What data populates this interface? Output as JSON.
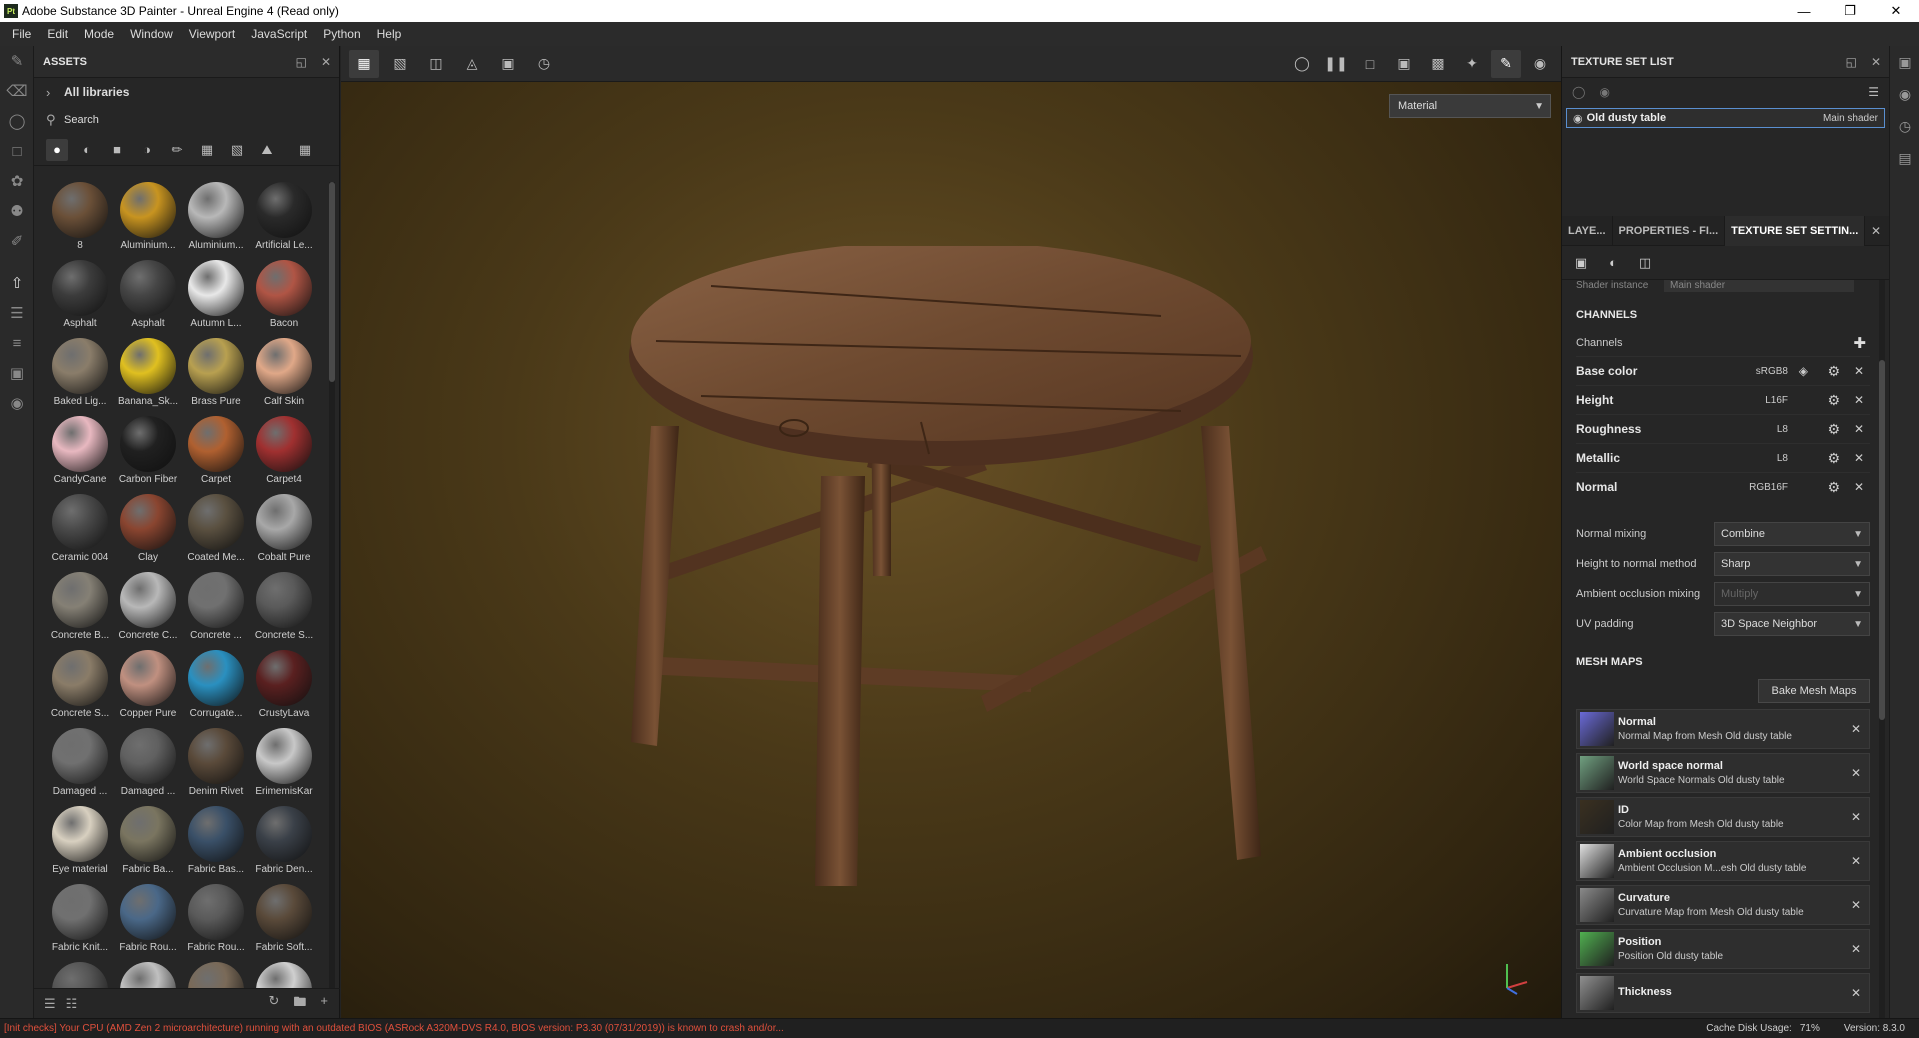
{
  "window": {
    "title": "Adobe Substance 3D Painter - Unreal Engine 4 (Read only)",
    "logo_text": "Pt",
    "minimize": "—",
    "maximize": "❐",
    "close": "✕"
  },
  "menu": [
    "File",
    "Edit",
    "Mode",
    "Window",
    "Viewport",
    "JavaScript",
    "Python",
    "Help"
  ],
  "assets": {
    "title": "ASSETS",
    "all_libraries": "All libraries",
    "search_placeholder": "Search",
    "items": [
      {
        "label": "8",
        "color": "#6b5038"
      },
      {
        "label": "Aluminium...",
        "color": "#c89420"
      },
      {
        "label": "Aluminium...",
        "color": "#b8b8b8"
      },
      {
        "label": "Artificial Le...",
        "color": "#2a2a2a"
      },
      {
        "label": "Asphalt",
        "color": "#3c3c3c"
      },
      {
        "label": "Asphalt",
        "color": "#454545"
      },
      {
        "label": "Autumn L...",
        "color": "#e8e8e8"
      },
      {
        "label": "Bacon",
        "color": "#b05545"
      },
      {
        "label": "Baked Lig...",
        "color": "#8a7d6a"
      },
      {
        "label": "Banana_Sk...",
        "color": "#e0c020"
      },
      {
        "label": "Brass Pure",
        "color": "#b8a050"
      },
      {
        "label": "Calf Skin",
        "color": "#e0a888"
      },
      {
        "label": "CandyCane",
        "color": "#e8b8c0"
      },
      {
        "label": "Carbon Fiber",
        "color": "#202020"
      },
      {
        "label": "Carpet",
        "color": "#b06030"
      },
      {
        "label": "Carpet4",
        "color": "#a03030"
      },
      {
        "label": "Ceramic 004",
        "color": "#4a4a4a"
      },
      {
        "label": "Clay",
        "color": "#8a4530"
      },
      {
        "label": "Coated Me...",
        "color": "#5a5040"
      },
      {
        "label": "Cobalt Pure",
        "color": "#a8a8a8"
      },
      {
        "label": "Concrete B...",
        "color": "#858075"
      },
      {
        "label": "Concrete C...",
        "color": "#b8b8b8"
      },
      {
        "label": "Concrete ...",
        "color": "#707070"
      },
      {
        "label": "Concrete S...",
        "color": "#5a5a5a"
      },
      {
        "label": "Concrete S...",
        "color": "#8a7c68"
      },
      {
        "label": "Copper Pure",
        "color": "#c09080"
      },
      {
        "label": "Corrugate...",
        "color": "#2a90c0"
      },
      {
        "label": "CrustyLava",
        "color": "#5a2020"
      },
      {
        "label": "Damaged ...",
        "color": "#707070"
      },
      {
        "label": "Damaged ...",
        "color": "#606060"
      },
      {
        "label": "Denim Rivet",
        "color": "#5a4a3a"
      },
      {
        "label": "ErimemisKar",
        "color": "#c8c8c8"
      },
      {
        "label": "Eye material",
        "color": "#d8d0c0"
      },
      {
        "label": "Fabric Ba...",
        "color": "#7a7560"
      },
      {
        "label": "Fabric Bas...",
        "color": "#3a5068"
      },
      {
        "label": "Fabric Den...",
        "color": "#3a4048"
      },
      {
        "label": "Fabric Knit...",
        "color": "#707070"
      },
      {
        "label": "Fabric Rou...",
        "color": "#4a6888"
      },
      {
        "label": "Fabric Rou...",
        "color": "#5a5a5a"
      },
      {
        "label": "Fabric Soft...",
        "color": "#5a4a3a"
      },
      {
        "label": "",
        "color": "#555555"
      },
      {
        "label": "",
        "color": "#c0c0c0"
      },
      {
        "label": "",
        "color": "#7a6a58"
      },
      {
        "label": "",
        "color": "#d0d0d0"
      }
    ]
  },
  "viewport": {
    "material_mode": "Material"
  },
  "texture_set_list": {
    "title": "TEXTURE SET LIST",
    "item_name": "Old dusty table",
    "item_shader": "Main shader"
  },
  "properties": {
    "tabs": [
      "LAYE...",
      "PROPERTIES - FI...",
      "TEXTURE SET SETTIN..."
    ],
    "cut_label": "Shader instance",
    "cut_value": "Main shader",
    "channels_title": "CHANNELS",
    "channels_label": "Channels",
    "channels": [
      {
        "name": "Base color",
        "format": "sRGB8"
      },
      {
        "name": "Height",
        "format": "L16F"
      },
      {
        "name": "Roughness",
        "format": "L8"
      },
      {
        "name": "Metallic",
        "format": "L8"
      },
      {
        "name": "Normal",
        "format": "RGB16F"
      }
    ],
    "settings": [
      {
        "label": "Normal mixing",
        "value": "Combine"
      },
      {
        "label": "Height to normal method",
        "value": "Sharp"
      },
      {
        "label": "Ambient occlusion mixing",
        "value": "Multiply"
      },
      {
        "label": "UV padding",
        "value": "3D Space Neighbor"
      }
    ],
    "mesh_maps_title": "MESH MAPS",
    "bake_button": "Bake Mesh Maps",
    "mesh_maps": [
      {
        "title": "Normal",
        "sub": "Normal Map from Mesh Old dusty table",
        "color": "#6a6ad8"
      },
      {
        "title": "World space normal",
        "sub": "World Space Normals Old dusty table",
        "color": "#70a080"
      },
      {
        "title": "ID",
        "sub": "Color Map from Mesh Old dusty table",
        "color": "#3a3020"
      },
      {
        "title": "Ambient occlusion",
        "sub": "Ambient Occlusion M...esh Old dusty table",
        "color": "#e0e0e0"
      },
      {
        "title": "Curvature",
        "sub": "Curvature Map from Mesh Old dusty table",
        "color": "#8a8a8a"
      },
      {
        "title": "Position",
        "sub": "Position Old dusty table",
        "color": "#50b050"
      },
      {
        "title": "Thickness",
        "sub": "",
        "color": "#909090"
      }
    ]
  },
  "status": {
    "warning": "[Init checks] Your CPU (AMD Zen 2 microarchitecture) running with an outdated BIOS (ASRock A320M-DVS R4.0, BIOS version: P3.30 (07/31/2019)) is known to crash and/or...",
    "cache": "Cache Disk Usage:",
    "cache_value": "71%",
    "version": "Version: 8.3.0"
  }
}
